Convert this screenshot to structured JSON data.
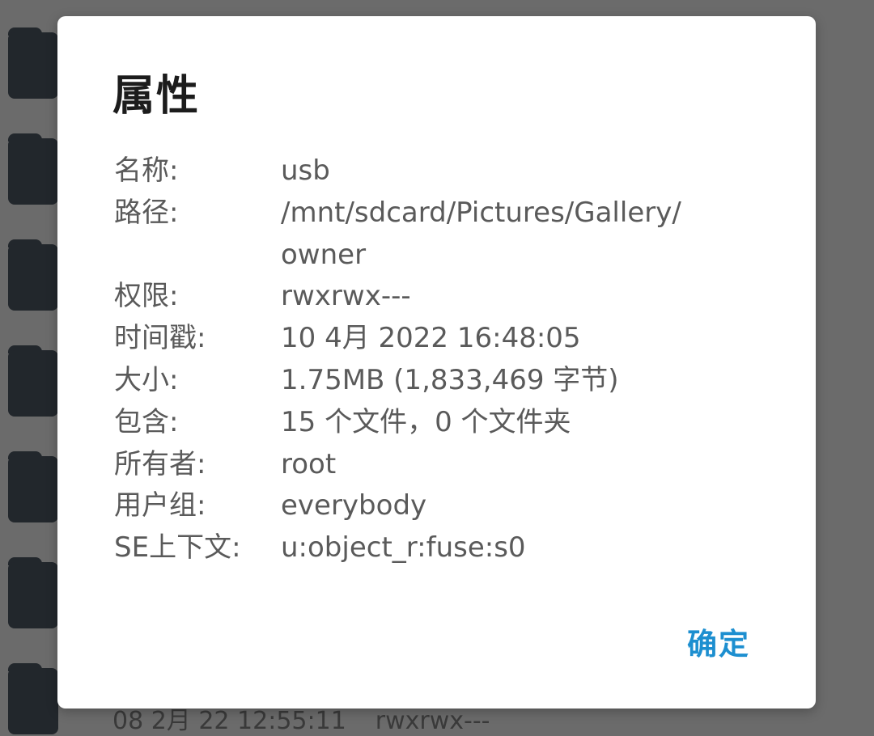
{
  "dialog": {
    "title": "属性",
    "confirm_label": "确定",
    "properties": [
      {
        "label": "名称:",
        "value": "usb"
      },
      {
        "label": "路径:",
        "value": "/mnt/sdcard/Pictures/Gallery/",
        "value2": "owner"
      },
      {
        "label": "权限:",
        "value": "rwxrwx---"
      },
      {
        "label": "时间戳:",
        "value": "10 4月 2022 16:48:05"
      },
      {
        "label": "大小:",
        "value": "1.75MB (1,833,469 字节)"
      },
      {
        "label": "包含:",
        "value": "15 个文件，0 个文件夹"
      },
      {
        "label": "所有者:",
        "value": "root"
      },
      {
        "label": "用户组:",
        "value": "everybody"
      },
      {
        "label": "SE上下文:",
        "value": "u:object_r:fuse:s0"
      }
    ]
  },
  "background": {
    "last_item": {
      "timestamp": "08 2月 22 12:55:11",
      "permissions": "rwxrwx---"
    }
  },
  "colors": {
    "accent": "#1d8fd0",
    "scrim": "#6b6b6b",
    "folder": "#22272c",
    "text": "#5a5a5a",
    "title": "#1c1c1c"
  }
}
